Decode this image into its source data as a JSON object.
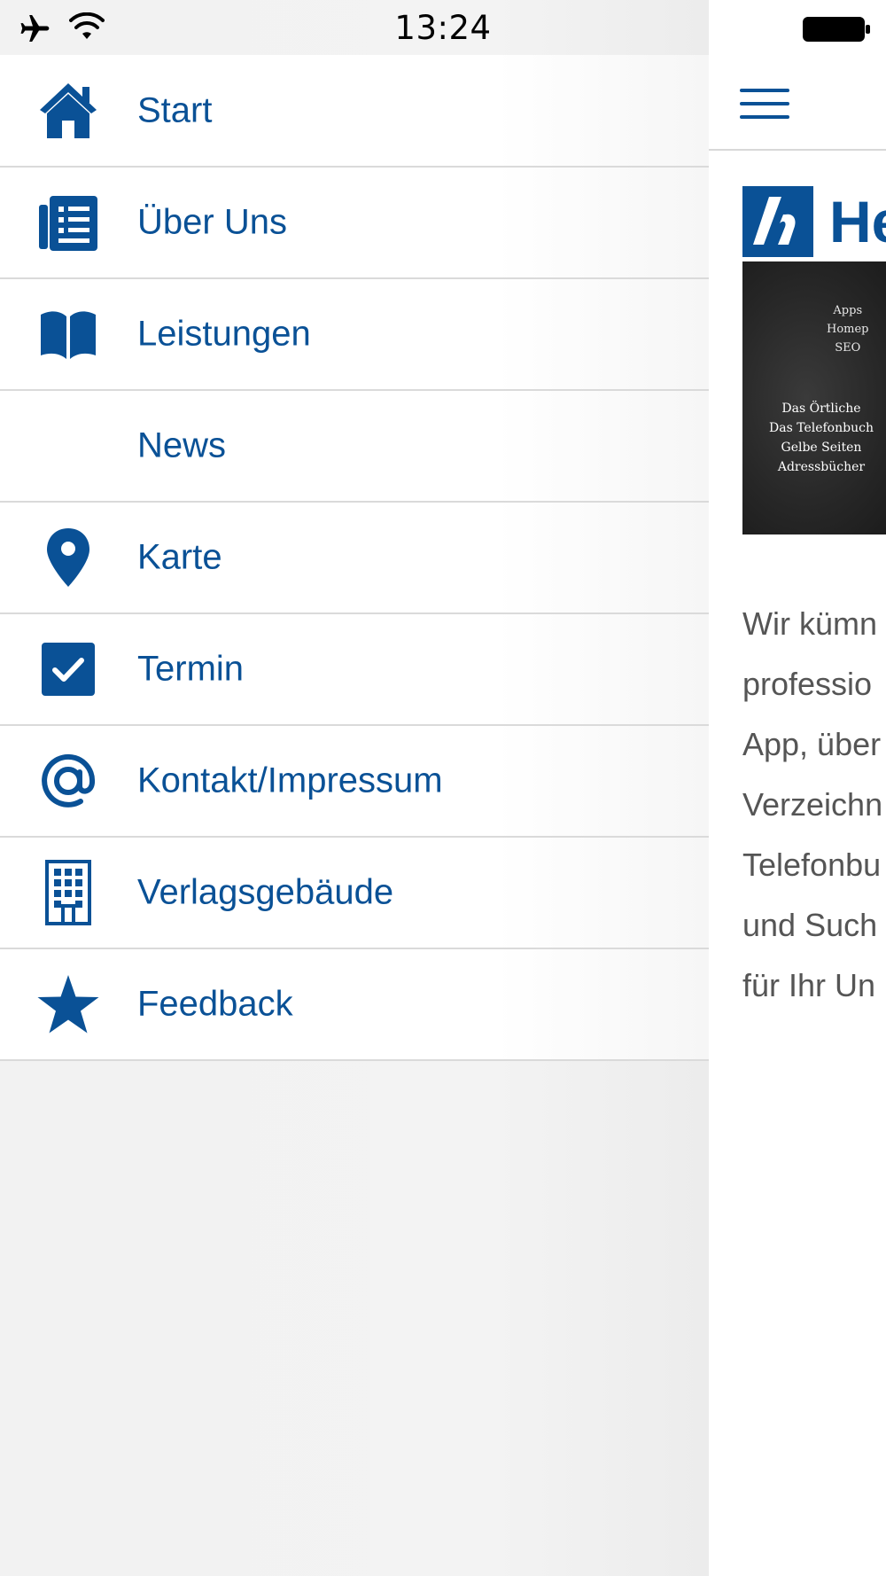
{
  "status_bar": {
    "time": "13:24"
  },
  "menu": {
    "items": [
      {
        "label": "Start",
        "icon": "home-icon"
      },
      {
        "label": "Über Uns",
        "icon": "newspaper-icon"
      },
      {
        "label": "Leistungen",
        "icon": "book-icon"
      },
      {
        "label": "News",
        "icon": ""
      },
      {
        "label": "Karte",
        "icon": "map-pin-icon"
      },
      {
        "label": "Termin",
        "icon": "checkbox-icon"
      },
      {
        "label": "Kontakt/Impressum",
        "icon": "at-sign-icon"
      },
      {
        "label": "Verlagsgebäude",
        "icon": "building-icon"
      },
      {
        "label": "Feedback",
        "icon": "star-icon"
      }
    ]
  },
  "main": {
    "logo_text": "He",
    "banner": {
      "top_lines": [
        "Apps",
        "Homep",
        "SEO"
      ],
      "bottom_lines": [
        "Das Örtliche",
        "Das Telefonbuch",
        "Gelbe Seiten",
        "Adressbücher"
      ]
    },
    "intro_lines": [
      "Wir kümn",
      "professio",
      "App, über",
      "Verzeichn",
      "Telefonbu",
      "und Such",
      "für Ihr Un"
    ]
  },
  "colors": {
    "accent": "#0a5196",
    "divider": "#dadada",
    "text_gray": "#555555"
  }
}
